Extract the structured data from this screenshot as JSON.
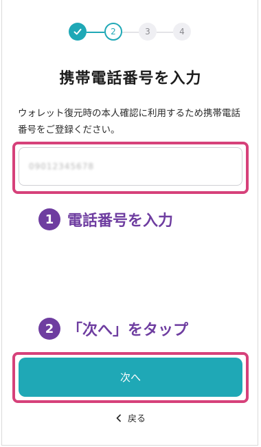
{
  "stepper": {
    "steps": [
      "",
      "2",
      "3",
      "4"
    ],
    "current": 2
  },
  "title": "携帯電話番号を入力",
  "description": "ウォレット復元時の本人確認に利用するため携帯電話番号をご登録ください。",
  "phone_input": {
    "value": "09012345678"
  },
  "annotations": [
    {
      "number": "1",
      "text": "電話番号を入力"
    },
    {
      "number": "2",
      "text": "「次へ」をタップ"
    }
  ],
  "next_button": {
    "label": "次へ"
  },
  "back_link": {
    "label": "戻る"
  },
  "colors": {
    "accent": "#1fa8b6",
    "highlight": "#d6417a",
    "annotation": "#6e3da0"
  }
}
